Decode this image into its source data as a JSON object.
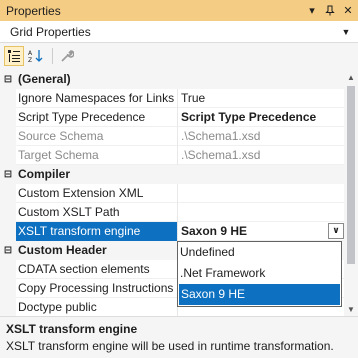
{
  "window": {
    "title": "Properties",
    "pin_glyph": "📌",
    "menu_glyph": "▾",
    "close_glyph": "✕"
  },
  "object_selector": {
    "value": "Grid Properties",
    "dropdown_glyph": "▼"
  },
  "toolbar": {
    "tools": [
      "categorized-icon",
      "alphabetical-icon",
      "property-pages-icon"
    ]
  },
  "grid": {
    "categories": [
      {
        "label": "(General)",
        "expander": "⊟",
        "rows": [
          {
            "name": "Ignore Namespaces for Links",
            "value": "True"
          },
          {
            "name": "Script Type Precedence",
            "value": "Script Type Precedence"
          },
          {
            "name": "Source Schema",
            "value": ".\\Schema1.xsd"
          },
          {
            "name": "Target Schema",
            "value": ".\\Schema1.xsd"
          }
        ]
      },
      {
        "label": "Compiler",
        "expander": "⊟",
        "rows": [
          {
            "name": "Custom Extension XML",
            "value": ""
          },
          {
            "name": "Custom XSLT Path",
            "value": ""
          },
          {
            "name": "XSLT transform engine",
            "value": "Saxon 9 HE"
          }
        ]
      },
      {
        "label": "Custom Header",
        "expander": "⊟",
        "rows": [
          {
            "name": "CDATA section elements",
            "value": ""
          },
          {
            "name": "Copy Processing Instructions",
            "value": ""
          },
          {
            "name": "Doctype public",
            "value": ""
          }
        ]
      }
    ],
    "combo_glyph": "∨"
  },
  "dropdown": {
    "options": [
      "Undefined",
      ".Net Framework",
      "Saxon 9 HE"
    ],
    "selected": "Saxon 9 HE"
  },
  "scrollbar": {
    "up_glyph": "▲",
    "down_glyph": "▼"
  },
  "description": {
    "title": "XSLT transform engine",
    "text": "XSLT transform engine will be used in runtime transformation."
  },
  "colors": {
    "title_bar": "#f5cc84",
    "selection": "#0e70c0"
  }
}
